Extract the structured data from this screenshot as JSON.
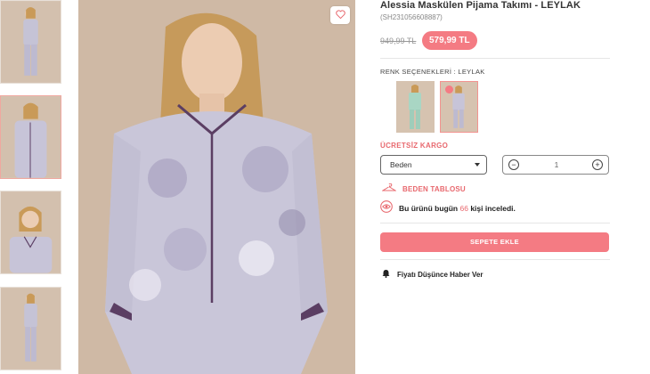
{
  "product": {
    "title": "Alessia Maskülen Pijama Takımı - LEYLAK",
    "sku": "(SH231056608887)",
    "old_price": "949,99 TL",
    "new_price": "579,99 TL"
  },
  "colors": {
    "label": "RENK SEÇENEKLERİ : LEYLAK",
    "options": [
      "mint-green",
      "lilac"
    ],
    "selected": "lilac"
  },
  "shipping": {
    "label": "ÜCRETSİZ KARGO"
  },
  "size_select": {
    "value": "Beden"
  },
  "quantity": {
    "value": "1",
    "minus": "−",
    "plus": "+"
  },
  "size_table": {
    "label": "BEDEN TABLOSU"
  },
  "viewers": {
    "prefix": "Bu ürünü bugün",
    "count": "66",
    "suffix": "kişi inceledi."
  },
  "add_to_cart": {
    "label": "SEPETE EKLE"
  },
  "price_alert": {
    "label": "Fiyatı Düşünce Haber Ver"
  },
  "icons": [
    "heart-icon",
    "hanger-icon",
    "eye-icon",
    "bell-icon",
    "caret-down-icon",
    "minus-icon",
    "plus-icon"
  ],
  "colors_theme": {
    "accent": "#f47b83",
    "accent_text": "#e8686e"
  }
}
